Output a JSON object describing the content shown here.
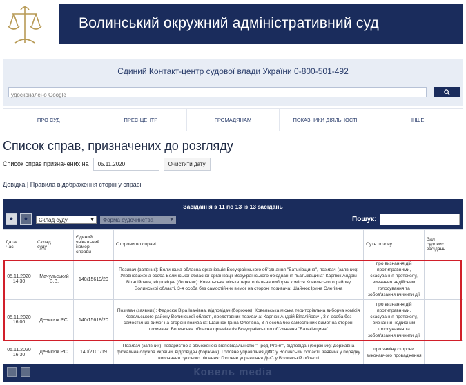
{
  "header": {
    "court_name": "Волинський окружний адміністративний суд"
  },
  "contact": {
    "title": "Єдиний Контакт-центр судової влади України 0-800-501-492",
    "search_placeholder": "удосконалено Google",
    "search_button_icon": "search-icon"
  },
  "nav": {
    "items": [
      "ПРО СУД",
      "ПРЕС-ЦЕНТР",
      "ГРОМАДЯНАМ",
      "ПОКАЗНИКИ ДІЯЛЬНОСТІ",
      "ІНШЕ"
    ]
  },
  "page": {
    "title": "Список справ, призначених до розгляду",
    "date_label": "Список справ призначених на",
    "date_value": "05.11.2020",
    "clear_button": "Очистити дату",
    "link_help": "Довідка",
    "link_separator": "|",
    "link_rules": "Правила відображення сторін у справі"
  },
  "panel": {
    "title": "Засідання з 11 по 13 із 13 засідань",
    "select_court": "Склад суду",
    "select_form": "Форма судочинства",
    "search_label": "Пошук:"
  },
  "table": {
    "headers": [
      "Дата/\nЧас",
      "Склад\nсуду",
      "Єдиний\nунікальний\nномер\nсправи",
      "Сторони по справі",
      "Суть позову",
      "Зал\nсудових\nзасідань"
    ],
    "rows": [
      {
        "datetime": "05.11.2020\n14:30",
        "judge": "Мачульський\nВ.В.",
        "number": "140/15619/20",
        "parties": "Позивач (заявник): Волинська обласна організація Всеукраїнського об'єднання \"Батьківщина\", позивач (заявник): Уповноважена особа Волинської обласної організації Всеукраїнського об'єднання \"Батьківщина\" Карпюк Андрій Віталійович, відповідач (боржник): Ковельська міська територіальна виборча комісія Ковельського району Волинської області, 3-я особа без самостійних вимог на стороні позивача: Шайнюк Ірина Олегівна",
        "essence": "про визнання дій протиправними, скасування протоколу, визнання недійсним голосування та зобов'язання вчинити дії",
        "hall": ""
      },
      {
        "datetime": "05.11.2020\n16:00",
        "judge": "Денисюк Р.С.",
        "number": "140/15618/20",
        "parties": "Позивач (заявник): Федосюк Віра Іванівна, відповідач (боржник): Ковельська міська територіальна виборча комісія Ковельського району Волинської області, представник позивача: Карпюк Андрій Віталійович, 3-я особа без самостійних вимог на стороні позивача: Шайнюк Ірина Олегівна, 3-я особа без самостійних вимог на стороні позивача: Волинська обласна організація Всеукраїнського об'єднання \"Батьківщина\"",
        "essence": "про визнання дій протиправними, скасування протоколу, визнання недійсним голосування та зобов'язання вчинити дії",
        "hall": ""
      },
      {
        "datetime": "05.11.2020\n16:30",
        "judge": "Денисюк Р.С.",
        "number": "140/2101/19",
        "parties": "Позивач (заявник): Товариство з обмеженою відповідальністю \"Прод-Ртейл\", відповідач (боржник): Державна фіскальна служба України, відповідач (боржник): Головне управління ДФС у Волинській області, заявник у порядку виконання судового рішення: Головне управління ДФС у Волинській області",
        "essence": "про заміну сторони виконавчого провадження",
        "hall": ""
      }
    ]
  },
  "footer": {
    "watermark": "Ковель media"
  }
}
